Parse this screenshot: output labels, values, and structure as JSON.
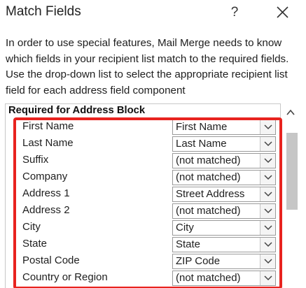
{
  "dialog": {
    "title": "Match Fields",
    "help_label": "?",
    "description": "In order to use special features, Mail Merge needs to know which fields in your recipient list match to the required fields. Use the drop-down list to select the appropriate recipient list field for each address field component"
  },
  "group": {
    "title": "Required for Address Block"
  },
  "fields": [
    {
      "label": "First Name",
      "value": "First Name"
    },
    {
      "label": "Last Name",
      "value": "Last Name"
    },
    {
      "label": "Suffix",
      "value": "(not matched)"
    },
    {
      "label": "Company",
      "value": "(not matched)"
    },
    {
      "label": "Address 1",
      "value": "Street Address"
    },
    {
      "label": "Address 2",
      "value": "(not matched)"
    },
    {
      "label": "City",
      "value": "City"
    },
    {
      "label": "State",
      "value": "State"
    },
    {
      "label": "Postal Code",
      "value": "ZIP Code"
    },
    {
      "label": "Country or Region",
      "value": "(not matched)"
    }
  ],
  "colors": {
    "highlight": "#e8231f",
    "scrollbar_thumb": "#c6c6c6"
  },
  "icons": {
    "close": "close-icon",
    "dropdown": "chevron-down-icon",
    "scroll_up": "chevron-up-icon"
  }
}
